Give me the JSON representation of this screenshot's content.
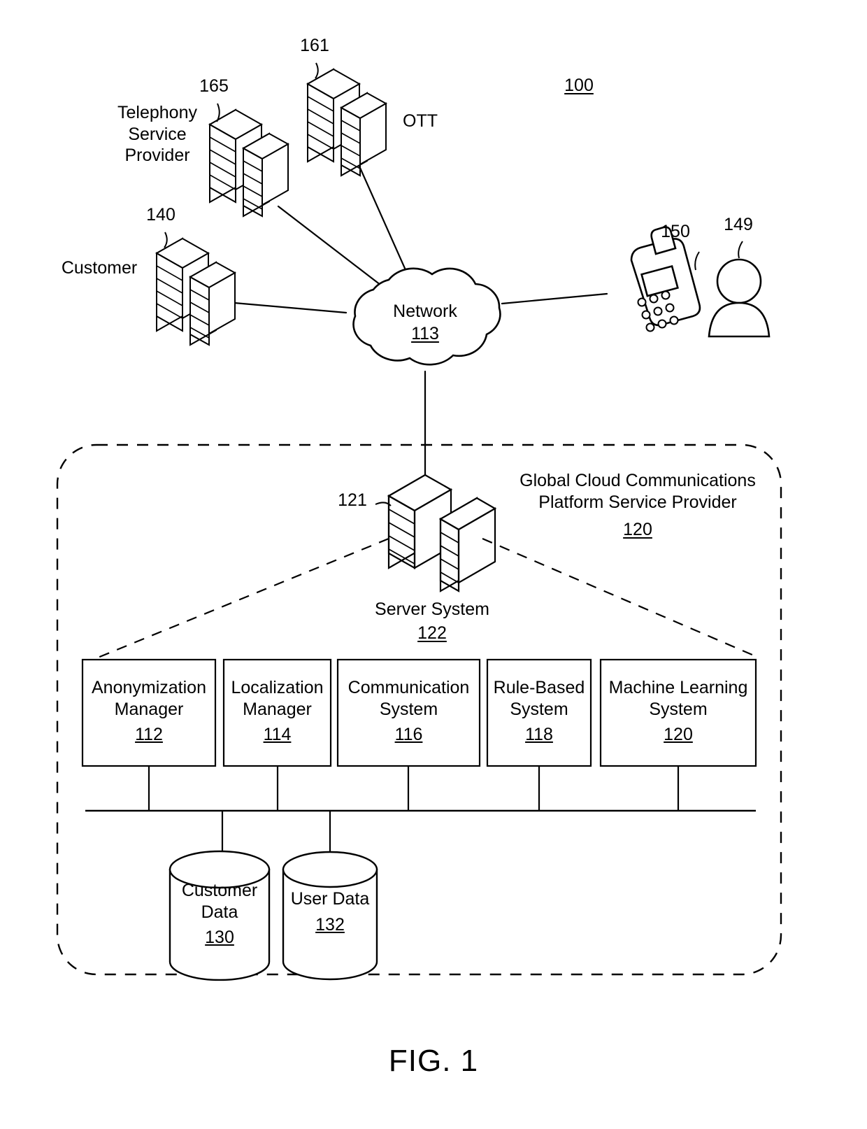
{
  "figure": {
    "caption": "FIG. 1",
    "system_ref": "100"
  },
  "top_nodes": {
    "telephony": {
      "label": "Telephony\nService\nProvider",
      "ref": "165",
      "icon": "server-rack-icon"
    },
    "ott": {
      "label": "OTT",
      "ref": "161",
      "icon": "server-rack-icon"
    },
    "customer": {
      "label": "Customer",
      "ref": "140",
      "icon": "server-rack-icon"
    },
    "mobile": {
      "ref": "150",
      "icon": "mobile-phone-icon"
    },
    "user": {
      "ref": "149",
      "icon": "person-icon"
    }
  },
  "network": {
    "label": "Network",
    "ref": "113",
    "icon": "cloud-icon"
  },
  "provider": {
    "title_line1": "Global Cloud Communications",
    "title_line2": "Platform Service Provider",
    "ref": "120"
  },
  "server": {
    "pointer_ref": "121",
    "label": "Server System",
    "ref": "122",
    "icon": "server-rack-icon"
  },
  "components": [
    {
      "name": "Anonymization",
      "name2": "Manager",
      "ref": "112"
    },
    {
      "name": "Localization",
      "name2": "Manager",
      "ref": "114"
    },
    {
      "name": "Communication",
      "name2": "System",
      "ref": "116"
    },
    {
      "name": "Rule-Based",
      "name2": "System",
      "ref": "118"
    },
    {
      "name": "Machine Learning",
      "name2": "System",
      "ref": "120"
    }
  ],
  "datastores": [
    {
      "name": "Customer",
      "name2": "Data",
      "ref": "130",
      "icon": "database-cylinder-icon"
    },
    {
      "name": "User Data",
      "name2": "",
      "ref": "132",
      "icon": "database-cylinder-icon"
    }
  ]
}
